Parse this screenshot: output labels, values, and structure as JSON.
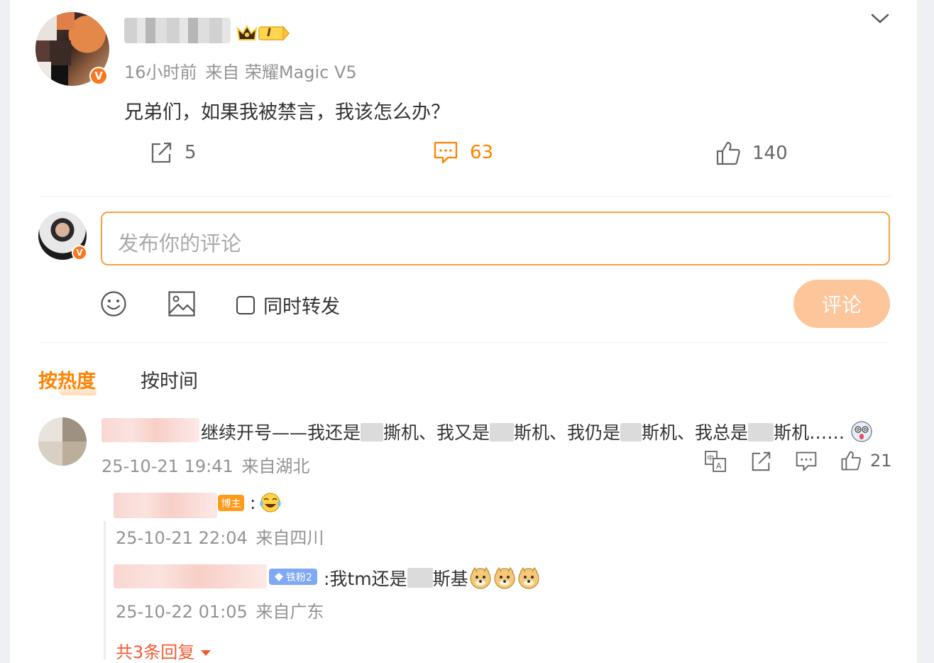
{
  "post": {
    "author_name": "**********",
    "time": "16小时前",
    "source": "来自 荣耀Magic V5",
    "text": "兄弟们，如果我被禁言，我该怎么办？",
    "verified_badge": "V",
    "level_badge": "I",
    "actions": {
      "share_count": "5",
      "comment_count": "63",
      "like_count": "140"
    }
  },
  "composer": {
    "placeholder": "发布你的评论",
    "repost_label": "同时转发",
    "submit_label": "评论",
    "verified_badge": "V"
  },
  "tabs": {
    "hot_label": "按热度",
    "time_label": "按时间"
  },
  "comments": [
    {
      "text_parts": [
        "继续开号——我还是",
        "撕机、我又是",
        "斯机、我仍是",
        "斯机、我总是",
        "斯机……"
      ],
      "time": "25-10-21 19:41",
      "location": "来自湖北",
      "like_count": "21",
      "replies": [
        {
          "badge": "博主",
          "text": ":",
          "time": "25-10-21 22:04",
          "location": "来自四川"
        },
        {
          "badge": "铁粉2",
          "text_before": ":我tm还是",
          "text_after": "斯基",
          "time": "25-10-22 01:05",
          "location": "来自广东"
        }
      ],
      "more_replies_label": "共3条回复"
    }
  ],
  "colors": {
    "accent": "#ff8200",
    "input_border": "#f8a23b",
    "submit_disabled": "#fdc59a",
    "more_replies": "#f25b33",
    "verified": "#f8781f"
  },
  "icons": [
    "chevron-down-icon",
    "share-icon",
    "comment-icon",
    "like-icon",
    "emoji-icon",
    "image-icon",
    "translate-icon"
  ]
}
